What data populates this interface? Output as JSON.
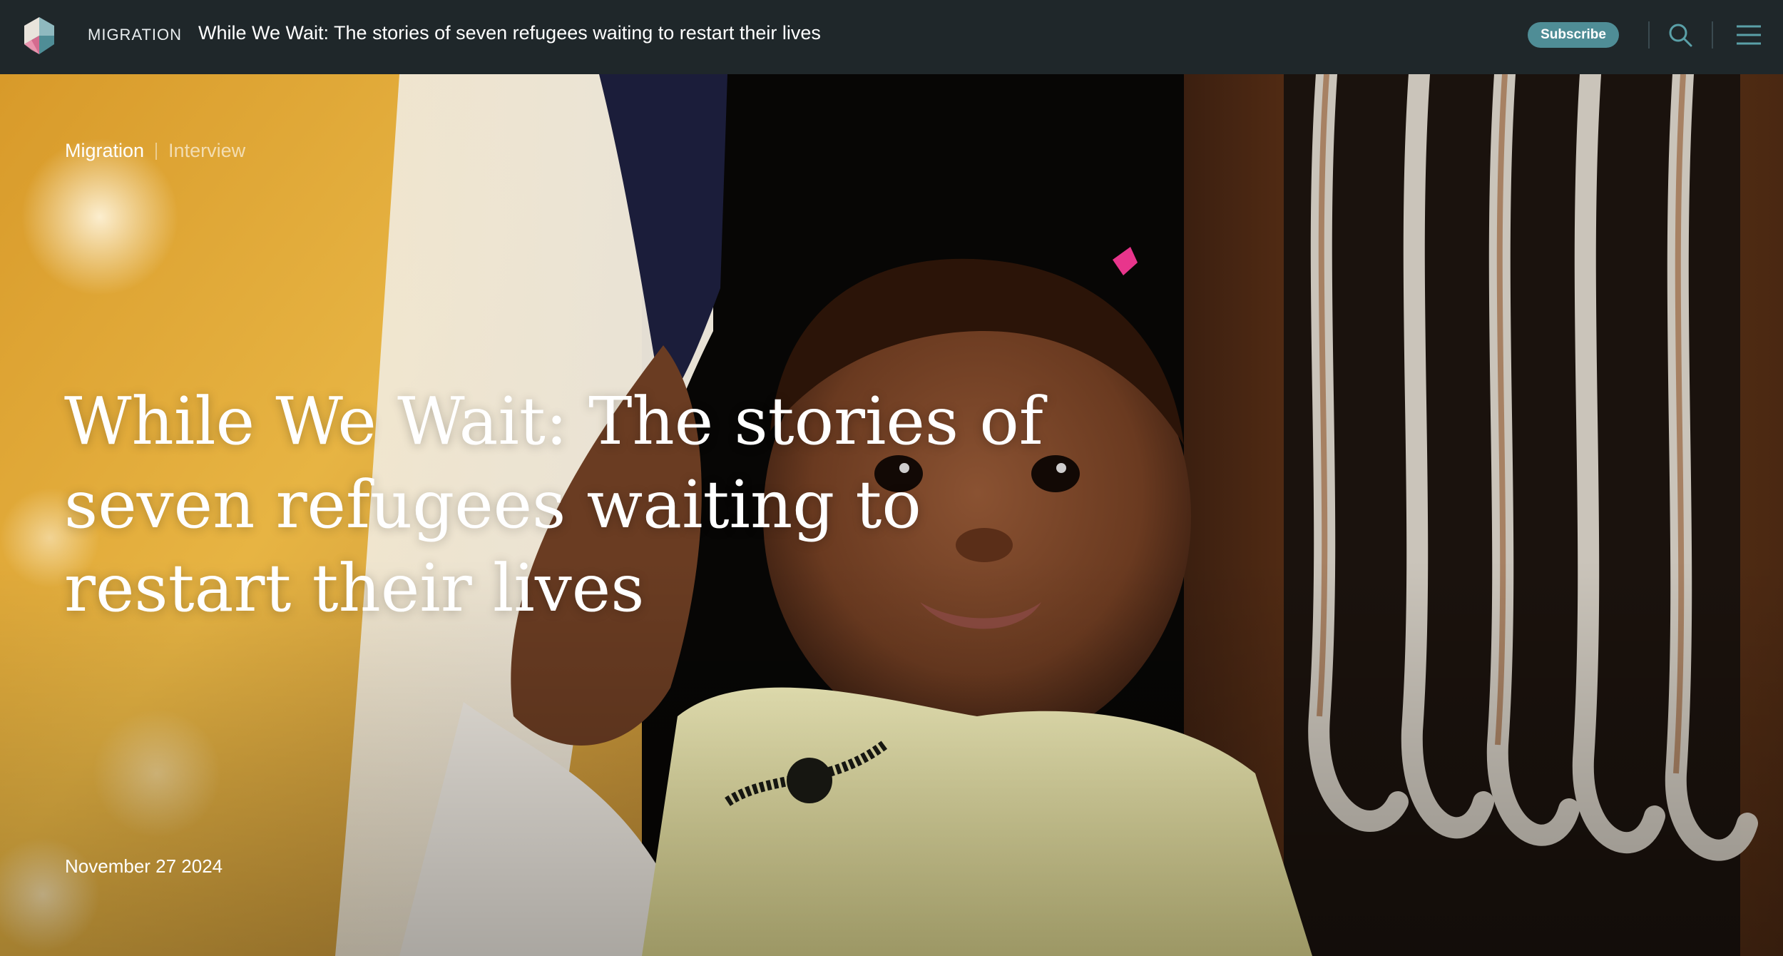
{
  "header": {
    "section_label": "MIGRATION",
    "title": "While We Wait: The stories of seven refugees waiting to restart their lives",
    "subscribe_label": "Subscribe",
    "icons": [
      "logo-mark",
      "search-icon",
      "hamburger-menu-icon"
    ]
  },
  "article": {
    "category": "Migration",
    "type": "Interview",
    "headline": "While We Wait: The stories of seven refugees waiting to restart their lives",
    "date": "November 27 2024"
  },
  "colors": {
    "topbar_bg": "#1f272a",
    "accent": "#4f8d96",
    "text": "#ffffff"
  }
}
